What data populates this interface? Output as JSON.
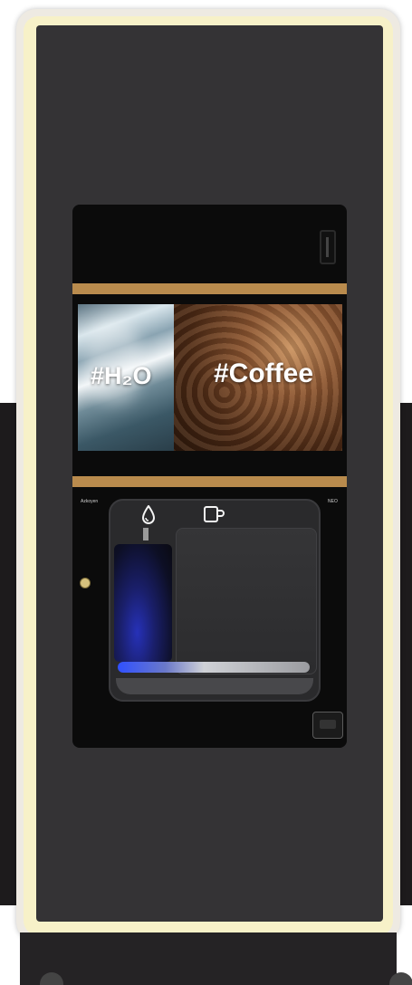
{
  "screen": {
    "left_tile_text": "#H₂O",
    "right_tile_text": "#Coffee"
  },
  "labels": {
    "brand": "Azkoyen",
    "model": "NEO"
  },
  "icons": {
    "water": "water-drop-icon",
    "cup": "coffee-cup-icon",
    "lock": "lock-icon",
    "coin": "coin-slot-icon",
    "card": "card-reader-icon"
  },
  "colors": {
    "trim": "#b98b4d",
    "cabinet_glow": "#f7f1c8",
    "body": "#343335",
    "blue_light": "#2631b8"
  }
}
